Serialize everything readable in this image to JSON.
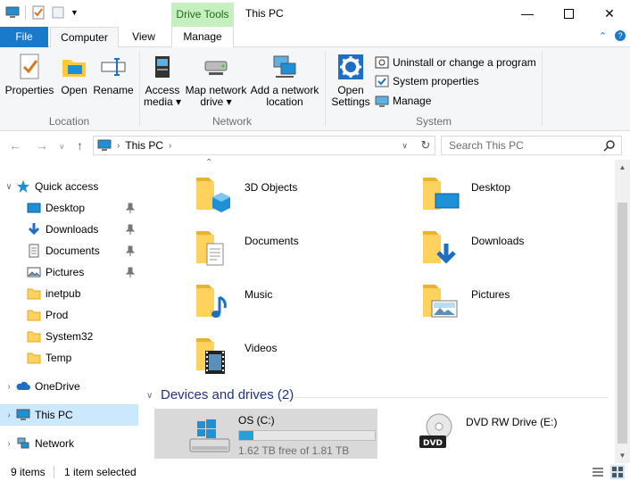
{
  "window": {
    "title": "This PC",
    "context_tab": "Drive Tools"
  },
  "tabs": {
    "file": "File",
    "computer": "Computer",
    "view": "View",
    "manage": "Manage"
  },
  "ribbon": {
    "location": {
      "label": "Location",
      "properties": "Properties",
      "open": "Open",
      "rename": "Rename"
    },
    "network": {
      "label": "Network",
      "access_media": "Access media",
      "map_network_drive": "Map network drive",
      "add_network_location": "Add a network location"
    },
    "system": {
      "label": "System",
      "open_settings": "Open Settings",
      "uninstall": "Uninstall or change a program",
      "system_properties": "System properties",
      "manage": "Manage"
    }
  },
  "address": {
    "path": "This PC",
    "search_placeholder": "Search This PC"
  },
  "nav": {
    "quick_access": "Quick access",
    "items": [
      {
        "label": "Desktop",
        "pinned": true
      },
      {
        "label": "Downloads",
        "pinned": true
      },
      {
        "label": "Documents",
        "pinned": true
      },
      {
        "label": "Pictures",
        "pinned": true
      },
      {
        "label": "inetpub",
        "pinned": false
      },
      {
        "label": "Prod",
        "pinned": false
      },
      {
        "label": "System32",
        "pinned": false
      },
      {
        "label": "Temp",
        "pinned": false
      }
    ],
    "onedrive": "OneDrive",
    "this_pc": "This PC",
    "network": "Network"
  },
  "folders": [
    {
      "label": "3D Objects",
      "icon": "3d-objects-folder-icon"
    },
    {
      "label": "Desktop",
      "icon": "desktop-folder-icon"
    },
    {
      "label": "Documents",
      "icon": "documents-folder-icon"
    },
    {
      "label": "Downloads",
      "icon": "downloads-folder-icon"
    },
    {
      "label": "Music",
      "icon": "music-folder-icon"
    },
    {
      "label": "Pictures",
      "icon": "pictures-folder-icon"
    },
    {
      "label": "Videos",
      "icon": "videos-folder-icon"
    }
  ],
  "devices": {
    "header": "Devices and drives (2)",
    "drives": [
      {
        "label": "OS (C:)",
        "free_text": "1.62 TB free of 1.81 TB",
        "used_fraction": 0.105
      },
      {
        "label": "DVD RW Drive (E:)"
      }
    ]
  },
  "status": {
    "items": "9 items",
    "selected": "1 item selected"
  },
  "colors": {
    "accent": "#1979ca",
    "selection": "#cce8ff",
    "drive_bar": "#26a0da",
    "section_header": "#1e3287"
  }
}
